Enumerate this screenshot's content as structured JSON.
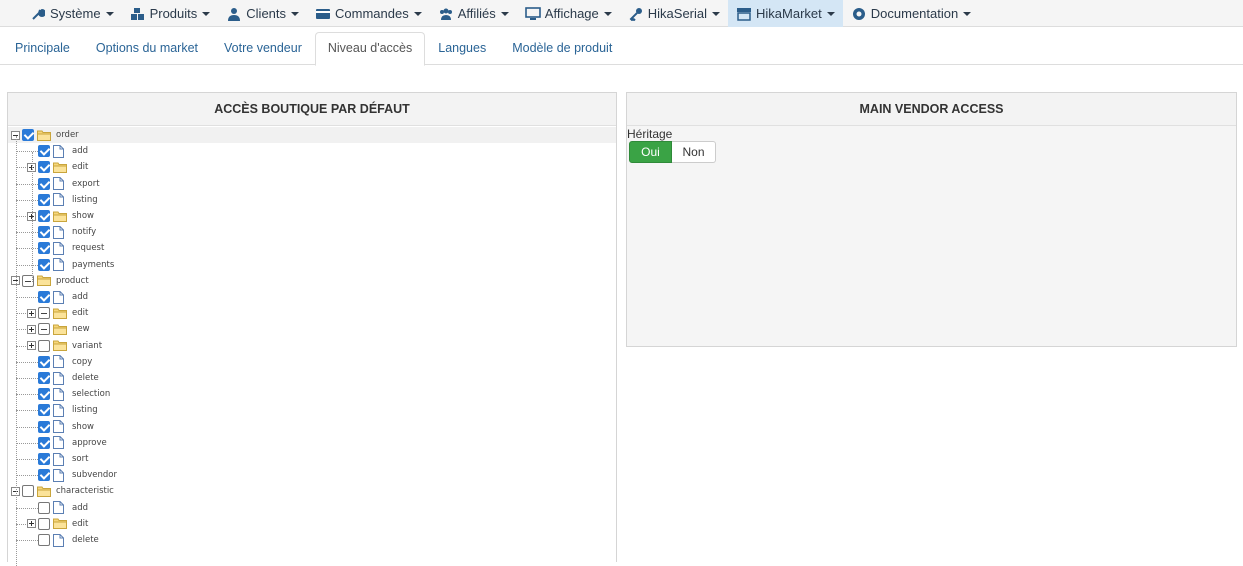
{
  "menu": [
    {
      "label": "Système",
      "icon": "wrench-icon",
      "has_caret": true,
      "active": false
    },
    {
      "label": "Produits",
      "icon": "cubes-icon",
      "has_caret": true,
      "active": false
    },
    {
      "label": "Clients",
      "icon": "user-icon",
      "has_caret": true,
      "active": false
    },
    {
      "label": "Commandes",
      "icon": "credit-card-icon",
      "has_caret": true,
      "active": false
    },
    {
      "label": "Affiliés",
      "icon": "users-icon",
      "has_caret": true,
      "active": false
    },
    {
      "label": "Affichage",
      "icon": "monitor-icon",
      "has_caret": true,
      "active": false
    },
    {
      "label": "HikaSerial",
      "icon": "key-icon",
      "has_caret": true,
      "active": false
    },
    {
      "label": "HikaMarket",
      "icon": "store-icon",
      "has_caret": true,
      "active": true
    },
    {
      "label": "Documentation",
      "icon": "life-ring-icon",
      "has_caret": true,
      "active": false
    }
  ],
  "tabs": [
    {
      "label": "Principale",
      "active": false
    },
    {
      "label": "Options du market",
      "active": false
    },
    {
      "label": "Votre vendeur",
      "active": false
    },
    {
      "label": "Niveau d'accès",
      "active": true
    },
    {
      "label": "Langues",
      "active": false
    },
    {
      "label": "Modèle de produit",
      "active": false
    }
  ],
  "left_panel": {
    "title": "ACCÈS BOUTIQUE PAR DÉFAUT",
    "tree": [
      {
        "label": "order",
        "level": 0,
        "type": "folder",
        "state": "checked",
        "expander": "minus"
      },
      {
        "label": "add",
        "level": 1,
        "type": "file",
        "state": "checked",
        "expander": "none"
      },
      {
        "label": "edit",
        "level": 1,
        "type": "folder",
        "state": "checked",
        "expander": "plus"
      },
      {
        "label": "export",
        "level": 1,
        "type": "file",
        "state": "checked",
        "expander": "none"
      },
      {
        "label": "listing",
        "level": 1,
        "type": "file",
        "state": "checked",
        "expander": "none"
      },
      {
        "label": "show",
        "level": 1,
        "type": "folder",
        "state": "checked",
        "expander": "plus"
      },
      {
        "label": "notify",
        "level": 1,
        "type": "file",
        "state": "checked",
        "expander": "none"
      },
      {
        "label": "request",
        "level": 1,
        "type": "file",
        "state": "checked",
        "expander": "none"
      },
      {
        "label": "payments",
        "level": 1,
        "type": "file",
        "state": "checked",
        "expander": "none"
      },
      {
        "label": "product",
        "level": 0,
        "type": "folder",
        "state": "partial",
        "expander": "minus"
      },
      {
        "label": "add",
        "level": 1,
        "type": "file",
        "state": "checked",
        "expander": "none"
      },
      {
        "label": "edit",
        "level": 1,
        "type": "folder",
        "state": "partial",
        "expander": "plus"
      },
      {
        "label": "new",
        "level": 1,
        "type": "folder",
        "state": "partial",
        "expander": "plus"
      },
      {
        "label": "variant",
        "level": 1,
        "type": "folder",
        "state": "unchecked",
        "expander": "plus"
      },
      {
        "label": "copy",
        "level": 1,
        "type": "file",
        "state": "checked",
        "expander": "none"
      },
      {
        "label": "delete",
        "level": 1,
        "type": "file",
        "state": "checked",
        "expander": "none"
      },
      {
        "label": "selection",
        "level": 1,
        "type": "file",
        "state": "checked",
        "expander": "none"
      },
      {
        "label": "listing",
        "level": 1,
        "type": "file",
        "state": "checked",
        "expander": "none"
      },
      {
        "label": "show",
        "level": 1,
        "type": "file",
        "state": "checked",
        "expander": "none"
      },
      {
        "label": "approve",
        "level": 1,
        "type": "file",
        "state": "checked",
        "expander": "none"
      },
      {
        "label": "sort",
        "level": 1,
        "type": "file",
        "state": "checked",
        "expander": "none"
      },
      {
        "label": "subvendor",
        "level": 1,
        "type": "file",
        "state": "checked",
        "expander": "none"
      },
      {
        "label": "characteristic",
        "level": 0,
        "type": "folder",
        "state": "unchecked",
        "expander": "minus"
      },
      {
        "label": "add",
        "level": 1,
        "type": "file",
        "state": "unchecked",
        "expander": "none"
      },
      {
        "label": "edit",
        "level": 1,
        "type": "folder",
        "state": "unchecked",
        "expander": "plus"
      },
      {
        "label": "delete",
        "level": 1,
        "type": "file",
        "state": "unchecked",
        "expander": "none"
      }
    ]
  },
  "right_panel": {
    "title": "MAIN VENDOR ACCESS",
    "heritage_label": "Héritage",
    "toggle": {
      "on_label": "Oui",
      "off_label": "Non",
      "selected": "Oui"
    }
  },
  "colors": {
    "accent": "#2a7ad8",
    "toggle_on": "#3aa345",
    "active_menu": "#d4e6f5",
    "link": "#2a6496"
  }
}
